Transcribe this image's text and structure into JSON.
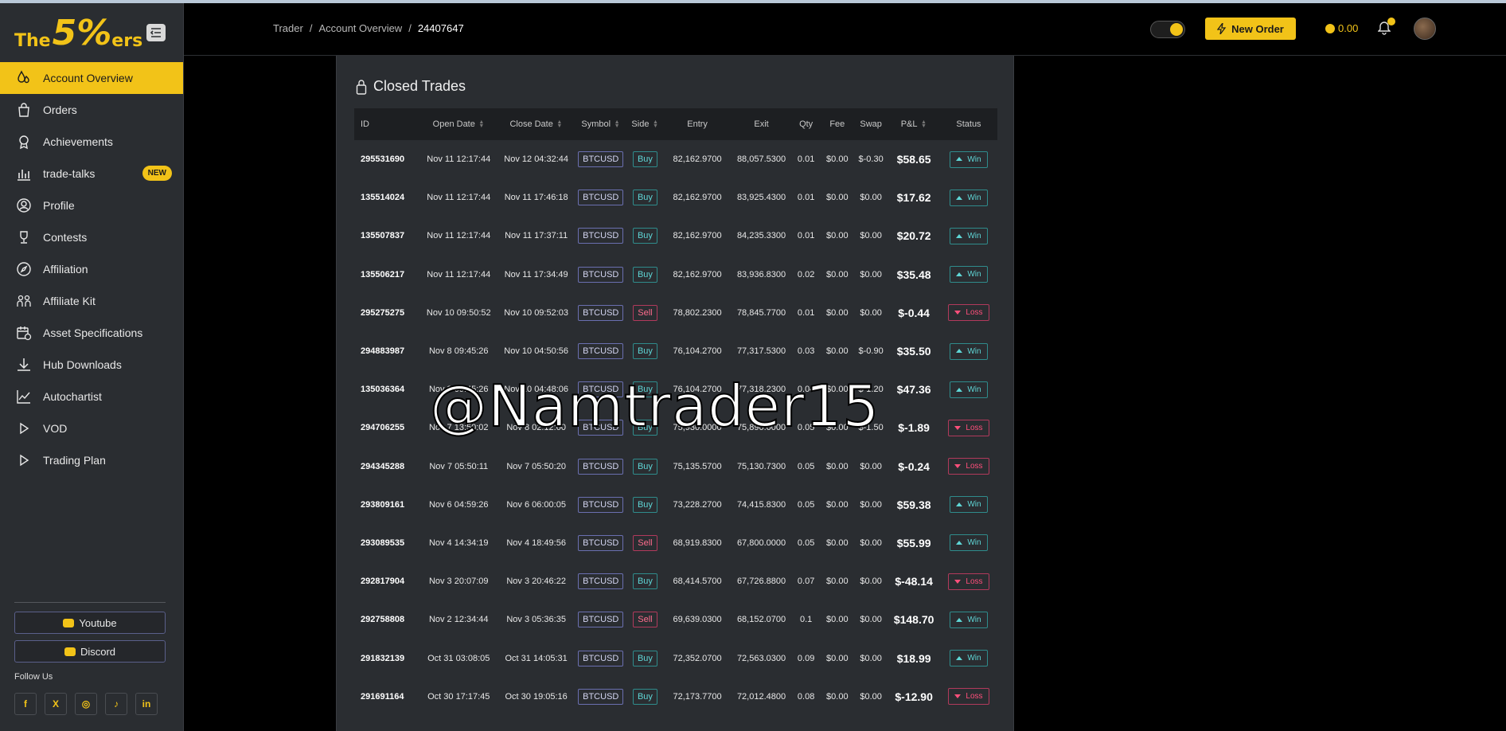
{
  "logo": {
    "the": "The",
    "five": "5%",
    "ers": "ers"
  },
  "sidebar": {
    "items": [
      {
        "label": "Account Overview",
        "icon": "drops-icon",
        "active": true
      },
      {
        "label": "Orders",
        "icon": "bag-icon"
      },
      {
        "label": "Achievements",
        "icon": "award-icon"
      },
      {
        "label": "trade-talks",
        "icon": "bar-chart-icon",
        "badge": "NEW"
      },
      {
        "label": "Profile",
        "icon": "user-circle-icon"
      },
      {
        "label": "Contests",
        "icon": "trophy-icon"
      },
      {
        "label": "Affiliation",
        "icon": "compass-icon"
      },
      {
        "label": "Affiliate Kit",
        "icon": "people-icon"
      },
      {
        "label": "Asset Specifications",
        "icon": "calendar-clock-icon"
      },
      {
        "label": "Hub Downloads",
        "icon": "download-icon"
      },
      {
        "label": "Autochartist",
        "icon": "line-chart-icon"
      },
      {
        "label": "VOD",
        "icon": "play-icon"
      },
      {
        "label": "Trading Plan",
        "icon": "play-icon"
      }
    ],
    "youtube": "Youtube",
    "discord": "Discord",
    "follow": "Follow Us",
    "socials": [
      "f",
      "X",
      "◎",
      "♪",
      "in"
    ]
  },
  "header": {
    "crumbs": [
      "Trader",
      "Account Overview",
      "24407647"
    ],
    "new_order": "New Order",
    "balance": "0.00",
    "notification_count": "0"
  },
  "panel": {
    "title": "Closed Trades",
    "columns": [
      "ID",
      "Open Date",
      "Close Date",
      "Symbol",
      "Side",
      "Entry",
      "Exit",
      "Qty",
      "Fee",
      "Swap",
      "P&L",
      "Status"
    ],
    "rows": [
      {
        "id": "295531690",
        "open": "Nov 11 12:17:44",
        "close": "Nov 12 04:32:44",
        "symbol": "BTCUSD",
        "side": "Buy",
        "entry": "82,162.9700",
        "exit": "88,057.5300",
        "qty": "0.01",
        "fee": "$0.00",
        "swap": "$-0.30",
        "pnl": "$58.65",
        "status": "Win"
      },
      {
        "id": "135514024",
        "open": "Nov 11 12:17:44",
        "close": "Nov 11 17:46:18",
        "symbol": "BTCUSD",
        "side": "Buy",
        "entry": "82,162.9700",
        "exit": "83,925.4300",
        "qty": "0.01",
        "fee": "$0.00",
        "swap": "$0.00",
        "pnl": "$17.62",
        "status": "Win"
      },
      {
        "id": "135507837",
        "open": "Nov 11 12:17:44",
        "close": "Nov 11 17:37:11",
        "symbol": "BTCUSD",
        "side": "Buy",
        "entry": "82,162.9700",
        "exit": "84,235.3300",
        "qty": "0.01",
        "fee": "$0.00",
        "swap": "$0.00",
        "pnl": "$20.72",
        "status": "Win"
      },
      {
        "id": "135506217",
        "open": "Nov 11 12:17:44",
        "close": "Nov 11 17:34:49",
        "symbol": "BTCUSD",
        "side": "Buy",
        "entry": "82,162.9700",
        "exit": "83,936.8300",
        "qty": "0.02",
        "fee": "$0.00",
        "swap": "$0.00",
        "pnl": "$35.48",
        "status": "Win"
      },
      {
        "id": "295275275",
        "open": "Nov 10 09:50:52",
        "close": "Nov 10 09:52:03",
        "symbol": "BTCUSD",
        "side": "Sell",
        "entry": "78,802.2300",
        "exit": "78,845.7700",
        "qty": "0.01",
        "fee": "$0.00",
        "swap": "$0.00",
        "pnl": "$-0.44",
        "status": "Loss"
      },
      {
        "id": "294883987",
        "open": "Nov 8 09:45:26",
        "close": "Nov 10 04:50:56",
        "symbol": "BTCUSD",
        "side": "Buy",
        "entry": "76,104.2700",
        "exit": "77,317.5300",
        "qty": "0.03",
        "fee": "$0.00",
        "swap": "$-0.90",
        "pnl": "$35.50",
        "status": "Win"
      },
      {
        "id": "135036364",
        "open": "Nov 8 09:45:26",
        "close": "Nov 10 04:48:06",
        "symbol": "BTCUSD",
        "side": "Buy",
        "entry": "76,104.2700",
        "exit": "77,318.2300",
        "qty": "0.04",
        "fee": "$0.00",
        "swap": "$-1.20",
        "pnl": "$47.36",
        "status": "Win"
      },
      {
        "id": "294706255",
        "open": "Nov 7 13:50:02",
        "close": "Nov 8 02:12:00",
        "symbol": "BTCUSD",
        "side": "Buy",
        "entry": "75,930.0000",
        "exit": "75,890.0000",
        "qty": "0.05",
        "fee": "$0.00",
        "swap": "$-1.50",
        "pnl": "$-1.89",
        "status": "Loss"
      },
      {
        "id": "294345288",
        "open": "Nov 7 05:50:11",
        "close": "Nov 7 05:50:20",
        "symbol": "BTCUSD",
        "side": "Buy",
        "entry": "75,135.5700",
        "exit": "75,130.7300",
        "qty": "0.05",
        "fee": "$0.00",
        "swap": "$0.00",
        "pnl": "$-0.24",
        "status": "Loss"
      },
      {
        "id": "293809161",
        "open": "Nov 6 04:59:26",
        "close": "Nov 6 06:00:05",
        "symbol": "BTCUSD",
        "side": "Buy",
        "entry": "73,228.2700",
        "exit": "74,415.8300",
        "qty": "0.05",
        "fee": "$0.00",
        "swap": "$0.00",
        "pnl": "$59.38",
        "status": "Win"
      },
      {
        "id": "293089535",
        "open": "Nov 4 14:34:19",
        "close": "Nov 4 18:49:56",
        "symbol": "BTCUSD",
        "side": "Sell",
        "entry": "68,919.8300",
        "exit": "67,800.0000",
        "qty": "0.05",
        "fee": "$0.00",
        "swap": "$0.00",
        "pnl": "$55.99",
        "status": "Win"
      },
      {
        "id": "292817904",
        "open": "Nov 3 20:07:09",
        "close": "Nov 3 20:46:22",
        "symbol": "BTCUSD",
        "side": "Buy",
        "entry": "68,414.5700",
        "exit": "67,726.8800",
        "qty": "0.07",
        "fee": "$0.00",
        "swap": "$0.00",
        "pnl": "$-48.14",
        "status": "Loss"
      },
      {
        "id": "292758808",
        "open": "Nov 2 12:34:44",
        "close": "Nov 3 05:36:35",
        "symbol": "BTCUSD",
        "side": "Sell",
        "entry": "69,639.0300",
        "exit": "68,152.0700",
        "qty": "0.1",
        "fee": "$0.00",
        "swap": "$0.00",
        "pnl": "$148.70",
        "status": "Win"
      },
      {
        "id": "291832139",
        "open": "Oct 31 03:08:05",
        "close": "Oct 31 14:05:31",
        "symbol": "BTCUSD",
        "side": "Buy",
        "entry": "72,352.0700",
        "exit": "72,563.0300",
        "qty": "0.09",
        "fee": "$0.00",
        "swap": "$0.00",
        "pnl": "$18.99",
        "status": "Win"
      },
      {
        "id": "291691164",
        "open": "Oct 30 17:17:45",
        "close": "Oct 30 19:05:16",
        "symbol": "BTCUSD",
        "side": "Buy",
        "entry": "72,173.7700",
        "exit": "72,012.4800",
        "qty": "0.08",
        "fee": "$0.00",
        "swap": "$0.00",
        "pnl": "$-12.90",
        "status": "Loss"
      }
    ]
  },
  "watermark": "@Namtrader15",
  "colors": {
    "accent": "#f2c318",
    "win": "#5fd6d6",
    "loss": "#ff4f7b",
    "panel": "#2a2d31"
  }
}
